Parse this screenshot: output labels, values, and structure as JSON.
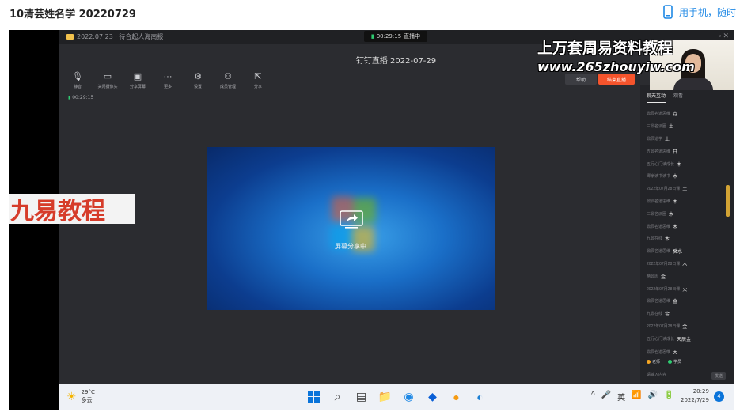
{
  "page": {
    "title": "10清芸姓名学 20220729",
    "mobile_link": "用手机，随时"
  },
  "app": {
    "folder_label": "2022.07.23 · 待合起人海南报",
    "rec_time": "00:29:15",
    "rec_status": "直播中",
    "live_title": "钉钉直播 2022-07-29",
    "toolbar": [
      {
        "icon": "mic-icon",
        "glyph": "🎙",
        "label": "静音"
      },
      {
        "icon": "camera-icon",
        "glyph": "▭",
        "label": "关闭摄像头"
      },
      {
        "icon": "screen-icon",
        "glyph": "▣",
        "label": "分享屏幕"
      },
      {
        "icon": "more-icon",
        "glyph": "···",
        "label": "更多"
      },
      {
        "icon": "gear-icon",
        "glyph": "⚙",
        "label": "设置"
      },
      {
        "icon": "user-icon",
        "glyph": "⚇",
        "label": "成员管理"
      },
      {
        "icon": "share-out-icon",
        "glyph": "⇱",
        "label": "分享"
      }
    ],
    "help_label": "帮助",
    "end_label": "结束直播",
    "timer": "00:29:15",
    "share_text": "屏幕分享中"
  },
  "watermarks": {
    "top": "上万套周易资料教程",
    "url": "www.265zhouyiw.com",
    "left": "九易教程"
  },
  "right_panel": {
    "tabs": [
      "聊天互动",
      "观看"
    ],
    "chat": [
      {
        "name": "鼎辰名道思维",
        "text": "垚"
      },
      {
        "name": "三鼎名派圈",
        "text": "土"
      },
      {
        "name": "鼎辰道学",
        "text": "土"
      },
      {
        "name": "五鼎名道思维",
        "text": "日"
      },
      {
        "name": "五行心门读成长",
        "text": "木"
      },
      {
        "name": "卿家读书读书",
        "text": "木"
      },
      {
        "name": "2022年07月28日课",
        "text": "土"
      },
      {
        "name": "鼎辰名道思维",
        "text": "木"
      },
      {
        "name": "三鼎名派圈",
        "text": "木"
      },
      {
        "name": "鼎辰名道思维",
        "text": "木"
      },
      {
        "name": "九鼎在线",
        "text": "木"
      },
      {
        "name": "鼎辰名道思维",
        "text": "癸水"
      },
      {
        "name": "2022年07月28日课",
        "text": "木"
      },
      {
        "name": "两鼎周",
        "text": "金"
      },
      {
        "name": "2022年07月28日课",
        "text": "火"
      },
      {
        "name": "鼎辰名道思维",
        "text": "金"
      },
      {
        "name": "九鼎在线",
        "text": "金"
      },
      {
        "name": "2022年07月28日课",
        "text": "金"
      },
      {
        "name": "五行心门读成长",
        "text": "天辰金"
      },
      {
        "name": "鼎辰名道思维",
        "text": "天"
      }
    ],
    "legend": [
      {
        "label": "老师",
        "color": "#f5a623"
      },
      {
        "label": "学员",
        "color": "#2ecc71"
      }
    ],
    "input_placeholder": "请输入内容",
    "send_label": "发送"
  },
  "taskbar": {
    "temp": "29°C",
    "weather": "多云",
    "apps": [
      {
        "icon": "windows-start-icon",
        "glyph": ""
      },
      {
        "icon": "search-icon",
        "glyph": "⌕"
      },
      {
        "icon": "task-view-icon",
        "glyph": "▤"
      },
      {
        "icon": "file-explorer-icon",
        "glyph": "📁"
      },
      {
        "icon": "edge-icon",
        "glyph": "◉"
      },
      {
        "icon": "app-blue-icon",
        "glyph": "◆"
      },
      {
        "icon": "app-orange-icon",
        "glyph": "●"
      },
      {
        "icon": "edge-browser-icon",
        "glyph": "◐"
      }
    ],
    "tray": [
      "^",
      "🎤",
      "英",
      "📶",
      "🔊",
      "🔋"
    ],
    "time": "20:29",
    "date": "2022/7/29",
    "notifications": "4"
  }
}
